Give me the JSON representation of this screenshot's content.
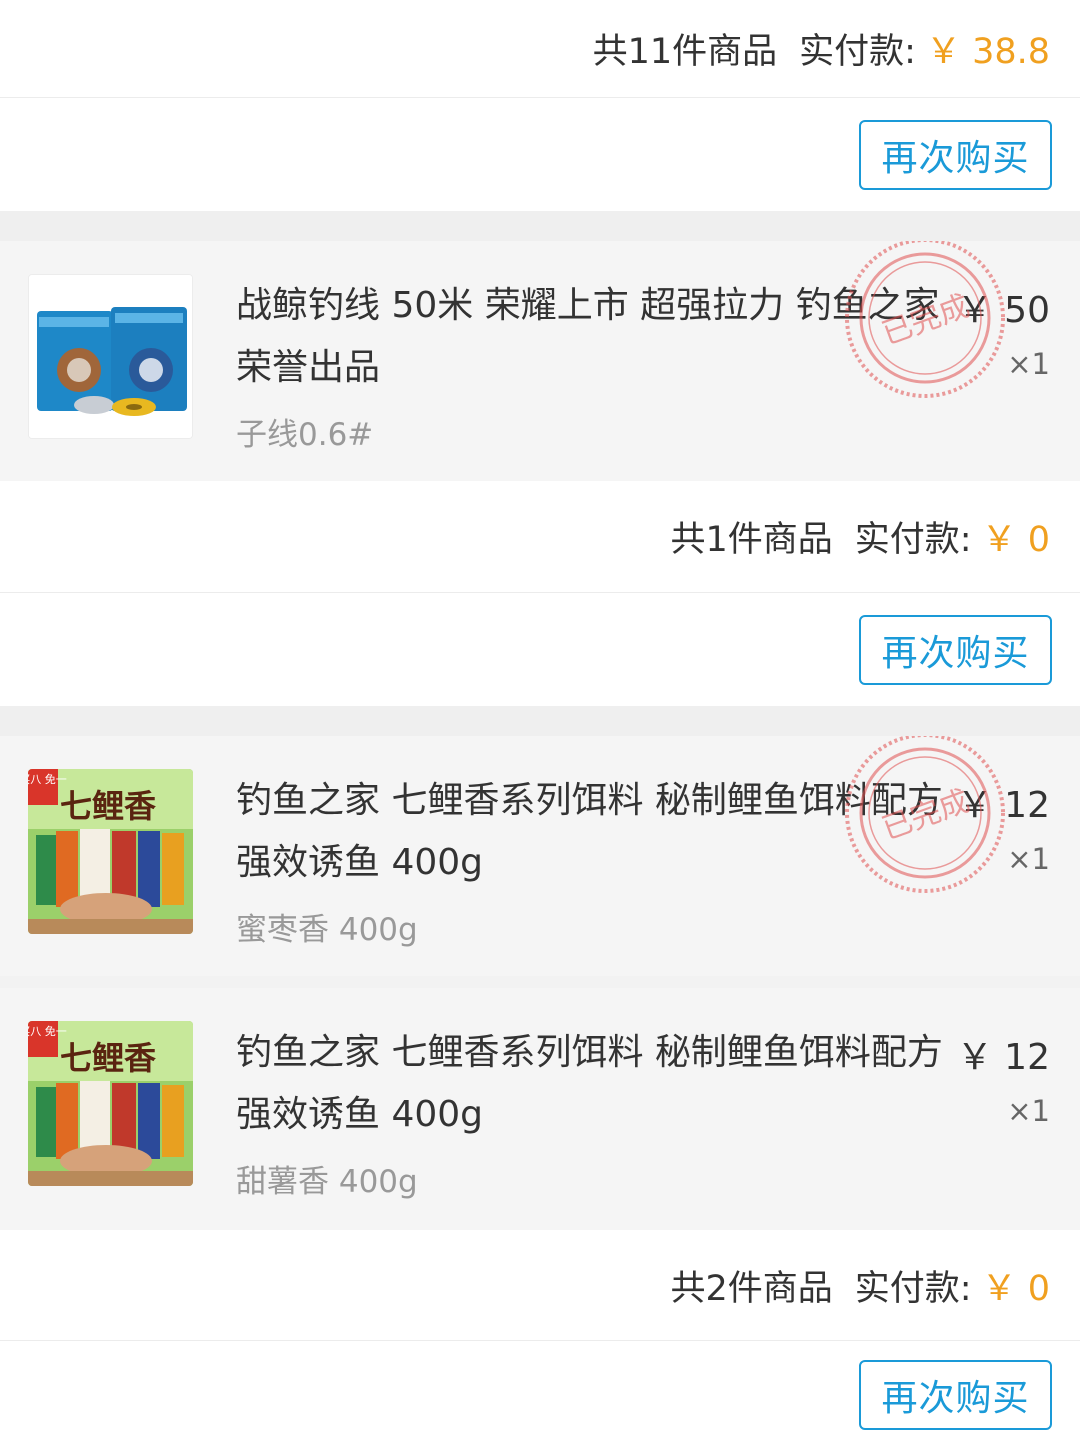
{
  "orders": [
    {
      "summary": {
        "count_text": "共11件商品",
        "paid_label": "实付款:",
        "paid_amount": "￥ 38.8"
      },
      "rebuy_label": "再次购买"
    },
    {
      "items": [
        {
          "title": "战鲸钓线 50米 荣耀上市 超强拉力 钓鱼之家荣誉出品",
          "spec": "子线0.6#",
          "price": "￥ 50",
          "qty": "×1",
          "stamp_text": "已完成"
        }
      ],
      "summary": {
        "count_text": "共1件商品",
        "paid_label": "实付款:",
        "paid_amount": "￥ 0"
      },
      "rebuy_label": "再次购买"
    },
    {
      "items": [
        {
          "title": "钓鱼之家 七鲤香系列饵料 秘制鲤鱼饵料配方 强效诱鱼 400g",
          "spec": "蜜枣香 400g",
          "price": "￥ 12",
          "qty": "×1",
          "stamp_text": "已完成",
          "thumb_badge": "买八 免一",
          "thumb_title": "七鲤香"
        },
        {
          "title": "钓鱼之家 七鲤香系列饵料 秘制鲤鱼饵料配方 强效诱鱼 400g",
          "spec": "甜薯香 400g",
          "price": "￥ 12",
          "qty": "×1",
          "thumb_badge": "买八 免一",
          "thumb_title": "七鲤香"
        }
      ],
      "summary": {
        "count_text": "共2件商品",
        "paid_label": "实付款:",
        "paid_amount": "￥ 0"
      },
      "rebuy_label": "再次购买"
    }
  ],
  "colors": {
    "accent": "#1a9ad8",
    "price": "#f0a020",
    "stamp": "#e05050"
  }
}
